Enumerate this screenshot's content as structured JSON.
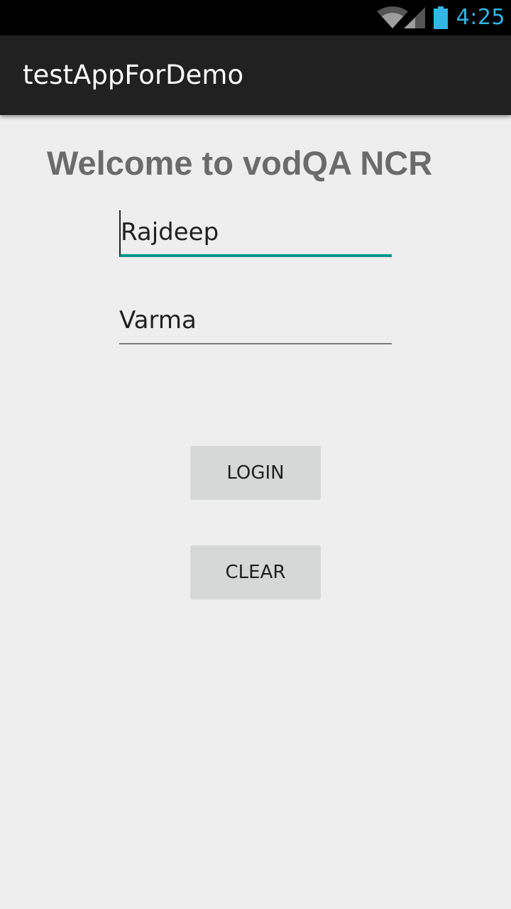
{
  "status_bar": {
    "time": "4:25",
    "icons": [
      "wifi-icon",
      "cellular-signal-icon",
      "battery-icon"
    ],
    "accent_color": "#33b5e5"
  },
  "action_bar": {
    "title": "testAppForDemo"
  },
  "main": {
    "heading": "Welcome to vodQA NCR",
    "username_value": "Rajdeep",
    "password_value": "Varma",
    "login_label": "LOGIN",
    "clear_label": "CLEAR"
  },
  "colors": {
    "focused_underline": "#009688",
    "background": "#eeeeee",
    "action_bar": "#212121"
  }
}
